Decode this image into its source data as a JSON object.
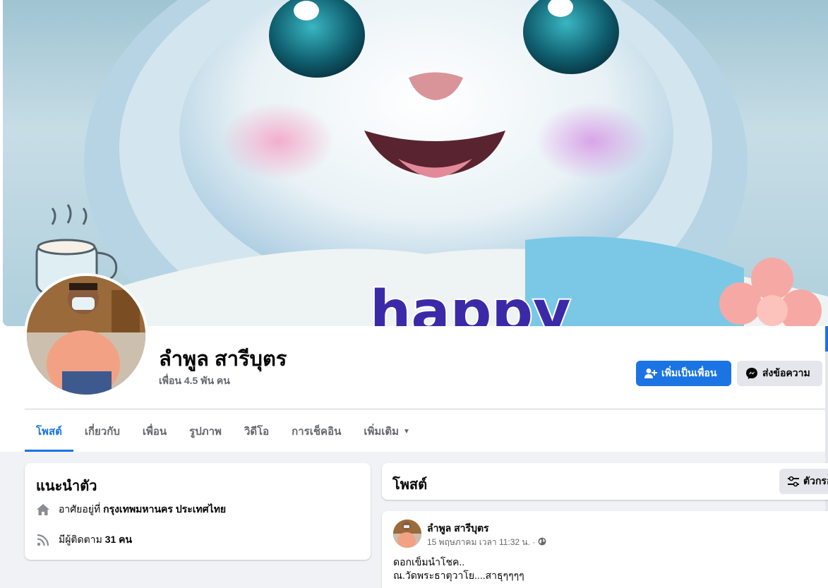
{
  "cover": {
    "caption_text": "happy"
  },
  "profile": {
    "name": "ลำพูล สารีบุตร",
    "friends": "เพื่อน 4.5 พัน คน",
    "add_friend_label": "เพิ่มเป็นเพื่อน",
    "message_label": "ส่งข้อความ"
  },
  "tabs": [
    {
      "label": "โพสต์",
      "active": true
    },
    {
      "label": "เกี่ยวกับ"
    },
    {
      "label": "เพื่อน"
    },
    {
      "label": "รูปภาพ"
    },
    {
      "label": "วิดีโอ"
    },
    {
      "label": "การเช็คอิน"
    },
    {
      "label": "เพิ่มเติม"
    }
  ],
  "intro": {
    "title": "แนะนำตัว",
    "lives_prefix": "อาศัยอยู่ที่ ",
    "lives_value": "กรุงเทพมหานคร ประเทศไทย",
    "followers_prefix": "มีผู้ติดตาม ",
    "followers_value": "31 คน"
  },
  "posts": {
    "title": "โพสต์",
    "filter_label": "ตัวกรอง"
  },
  "post": {
    "author": "ลำพูล สารีบุตร",
    "timestamp": "15 พฤษภาคม เวลา 11:32 น. ·",
    "line1": "ดอกเข็มนำโชค..",
    "line2": "ณ.วัดพระธาตุวาโย....สาธุๆๆๆๆ"
  },
  "icons": [
    "add-friend-icon",
    "messenger-icon",
    "home-icon",
    "rss-icon",
    "filter-icon",
    "globe-icon",
    "caret-down-icon"
  ],
  "colors": {
    "accent": "#1b74e4",
    "secondary_text": "#65676b",
    "page_bg": "#f0f2f5"
  }
}
